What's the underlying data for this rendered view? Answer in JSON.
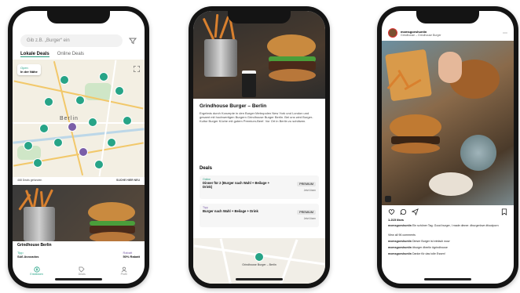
{
  "phone1": {
    "search_placeholder": "Gib z.B. „Burger“ ein",
    "tabs": [
      "Lokale Deals",
      "Online Deals"
    ],
    "map_chip": {
      "line1": "Open",
      "line2": "In der Nähe"
    },
    "map_city": "Berlin",
    "map_footer": {
      "left": "468 Deals gefunden",
      "right": "SUCHE HIER NEU"
    },
    "deal": {
      "title": "Grindhouse Berlin",
      "left_label": "Tipp",
      "left_value": "Süß Avocados",
      "right_label": "Rabatt",
      "right_value": "50% Rabatt"
    },
    "nav": [
      "Entdecken",
      "Deals",
      "Profil"
    ]
  },
  "phone2": {
    "title": "Grindhouse Burger – Berlin",
    "description": "Ergebnis durch Konzepte in den Burger Metropolen New York und London und gesamt mit hochwertigen Burgern Grindhouse Burger Berlin. Bei uns wird Burger-Kultur Burger Küche mit gutem Premium-Beef. Vor Ort in Berlin zu schätzen.",
    "deals_heading": "Deals",
    "deals": [
      {
        "tag": "Online",
        "text": "Dinner für 2 (Burger nach Wahl + Beilage + Drink)",
        "price": "PREMIUM",
        "sub": "Jetzt lösen"
      },
      {
        "tag": "Tipp",
        "text": "Burger nach Wahl + Beilage + Drink",
        "price": "PREMIUM",
        "sub": "Jetzt lösen"
      }
    ],
    "map_label": "Grindhouse Burger – Berlin"
  },
  "phone3": {
    "username": "momsgoeshuntin",
    "location": "Grindhouse – Grindhouse Burger",
    "likes": "1.215 likes",
    "captions": [
      {
        "user": "momsgoeshuntin",
        "text": "Ein schöner Tag. Good burger, I made dinner. #burgerlove #foodporn"
      },
      {
        "user": "",
        "text": "View all 96 comments"
      },
      {
        "user": "momsgoeshuntin",
        "text": "Dieser Burger ist einfach wow"
      },
      {
        "user": "momsgoeshuntin",
        "text": "#burger #berlin #grindhouse"
      },
      {
        "user": "momsgoeshuntin",
        "text": "Danke für das tolle Essen!"
      }
    ]
  },
  "colors": {
    "accent": "#27a487",
    "purple": "#7a5ea8"
  }
}
